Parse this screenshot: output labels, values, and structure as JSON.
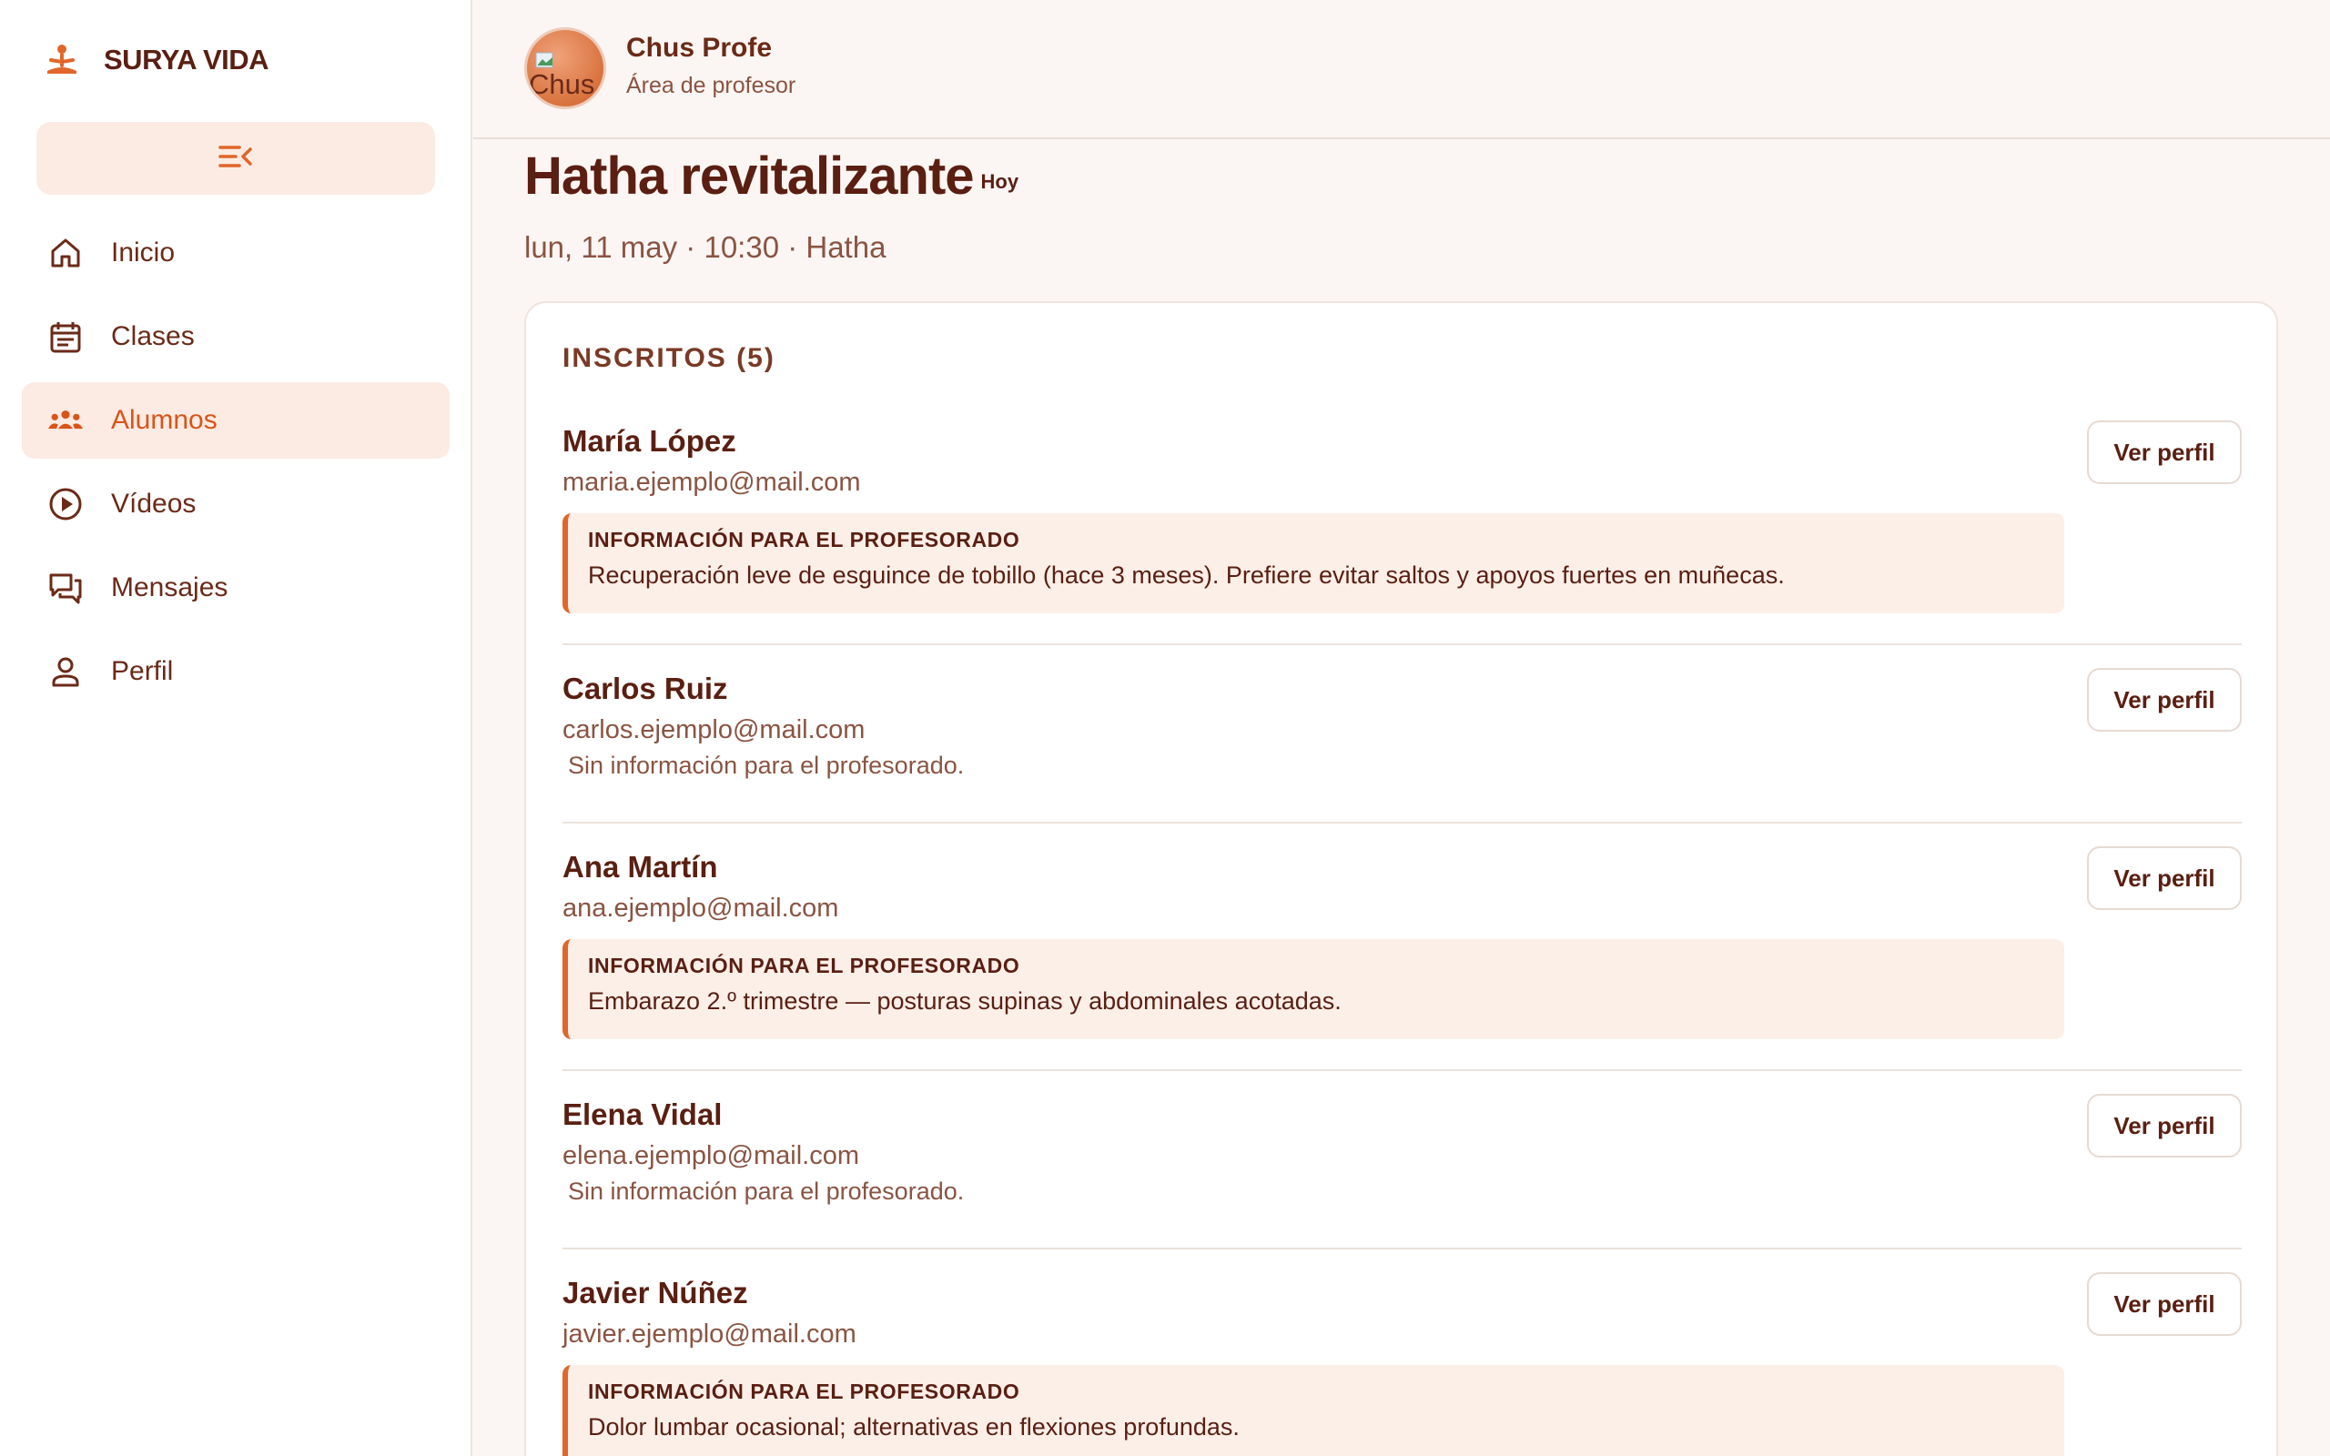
{
  "brand": {
    "name": "SURYA VIDA",
    "accent": "#e0662a"
  },
  "sidebar": {
    "collapse_icon": "menu-collapse-icon",
    "items": [
      {
        "label": "Inicio",
        "icon": "home-icon",
        "active": false
      },
      {
        "label": "Clases",
        "icon": "calendar-icon",
        "active": false
      },
      {
        "label": "Alumnos",
        "icon": "users-icon",
        "active": true
      },
      {
        "label": "Vídeos",
        "icon": "play-circle-icon",
        "active": false
      },
      {
        "label": "Mensajes",
        "icon": "chat-icon",
        "active": false
      },
      {
        "label": "Perfil",
        "icon": "person-icon",
        "active": false
      }
    ]
  },
  "header": {
    "avatar_alt": "Chus",
    "user_name": "Chus Profe",
    "user_role": "Área de profesor"
  },
  "class": {
    "title": "Hatha revitalizante",
    "badge": "Hoy",
    "subtitle": "lun, 11 may · 10:30 · Hatha"
  },
  "enrolled": {
    "title": "INSCRITOS (5)",
    "view_label": "Ver perfil",
    "note_label": "INFORMACIÓN PARA EL PROFESORADO",
    "no_note_text": "Sin información para el profesorado.",
    "students": [
      {
        "name": "María López",
        "email": "maria.ejemplo@mail.com",
        "note": "Recuperación leve de esguince de tobillo (hace 3 meses). Prefiere evitar saltos y apoyos fuertes en muñecas."
      },
      {
        "name": "Carlos Ruiz",
        "email": "carlos.ejemplo@mail.com",
        "note": ""
      },
      {
        "name": "Ana Martín",
        "email": "ana.ejemplo@mail.com",
        "note": "Embarazo 2.º trimestre — posturas supinas y abdominales acotadas."
      },
      {
        "name": "Elena Vidal",
        "email": "elena.ejemplo@mail.com",
        "note": ""
      },
      {
        "name": "Javier Núñez",
        "email": "javier.ejemplo@mail.com",
        "note": "Dolor lumbar ocasional; alternativas en flexiones profundas."
      }
    ]
  }
}
